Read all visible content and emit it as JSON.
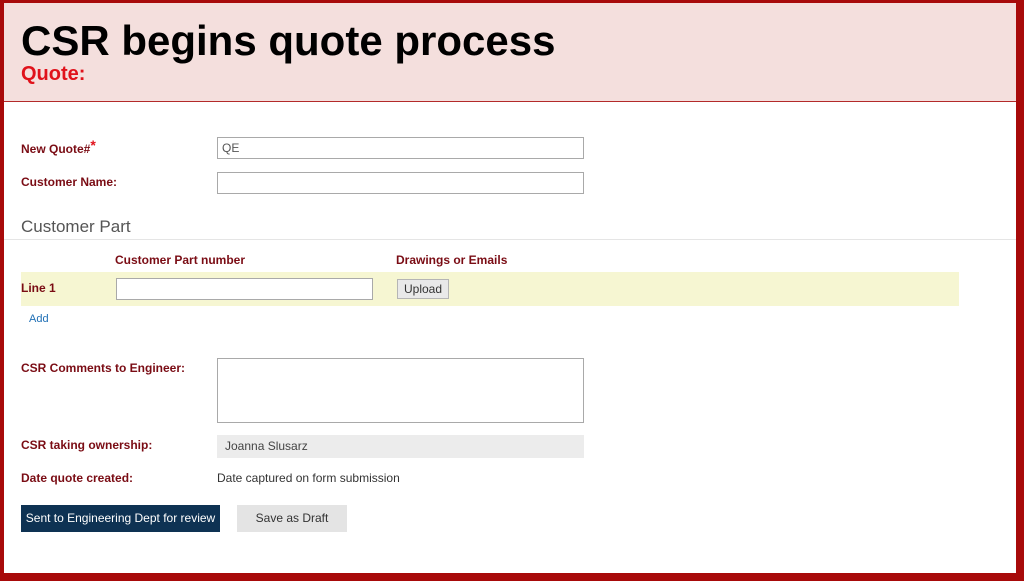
{
  "header": {
    "title": "CSR begins quote process",
    "subtitle": "Quote:"
  },
  "form": {
    "new_quote": {
      "label": "New Quote#",
      "required_mark": "*",
      "value": "QE"
    },
    "customer_name": {
      "label": "Customer Name:",
      "value": ""
    },
    "customer_part": {
      "section_title": "Customer Part",
      "columns": [
        "Customer Part number",
        "Drawings or Emails"
      ],
      "lines": [
        {
          "label": "Line 1",
          "part_number": "",
          "upload_label": "Upload"
        }
      ],
      "add_label": "Add"
    },
    "csr_comments": {
      "label": "CSR Comments to Engineer:",
      "value": ""
    },
    "csr_owner": {
      "label": "CSR taking ownership:",
      "value": "Joanna Slusarz"
    },
    "date_created": {
      "label": "Date quote created:",
      "value": "Date captured on form submission"
    }
  },
  "actions": {
    "submit_label": "Sent to Engineering Dept for review",
    "draft_label": "Save as Draft"
  },
  "colors": {
    "border": "#a80a0a",
    "header_bg": "#f4dfdd",
    "label": "#7a0c14",
    "accent_red": "#e0121b",
    "line_row_bg": "#f6f6d2",
    "primary_button": "#0e3253",
    "link": "#1f6fb5"
  }
}
